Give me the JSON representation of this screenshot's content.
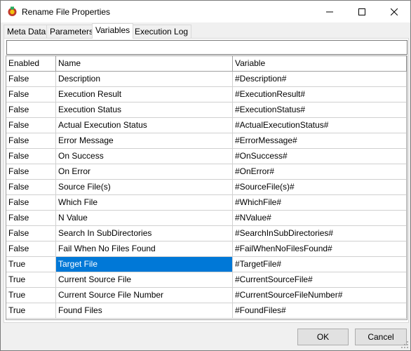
{
  "window": {
    "title": "Rename File Properties"
  },
  "tabs": [
    {
      "label": "Meta Data"
    },
    {
      "label": "Parameters"
    },
    {
      "label": "Variables"
    },
    {
      "label": "Execution Log"
    }
  ],
  "active_tab": "Variables",
  "filter": {
    "value": ""
  },
  "grid": {
    "headers": [
      "Enabled",
      "Name",
      "Variable"
    ],
    "rows": [
      {
        "enabled": "False",
        "name": "Description",
        "variable": "#Description#"
      },
      {
        "enabled": "False",
        "name": "Execution Result",
        "variable": "#ExecutionResult#"
      },
      {
        "enabled": "False",
        "name": "Execution Status",
        "variable": "#ExecutionStatus#"
      },
      {
        "enabled": "False",
        "name": "Actual Execution Status",
        "variable": "#ActualExecutionStatus#"
      },
      {
        "enabled": "False",
        "name": "Error Message",
        "variable": "#ErrorMessage#"
      },
      {
        "enabled": "False",
        "name": "On Success",
        "variable": "#OnSuccess#"
      },
      {
        "enabled": "False",
        "name": "On Error",
        "variable": "#OnError#"
      },
      {
        "enabled": "False",
        "name": "Source File(s)",
        "variable": "#SourceFile(s)#"
      },
      {
        "enabled": "False",
        "name": "Which File",
        "variable": "#WhichFile#"
      },
      {
        "enabled": "False",
        "name": "N Value",
        "variable": "#NValue#"
      },
      {
        "enabled": "False",
        "name": "Search In SubDirectories",
        "variable": "#SearchInSubDirectories#"
      },
      {
        "enabled": "False",
        "name": "Fail When No Files Found",
        "variable": "#FailWhenNoFilesFound#"
      },
      {
        "enabled": "True",
        "name": "Target File",
        "variable": "#TargetFile#"
      },
      {
        "enabled": "True",
        "name": "Current Source File",
        "variable": "#CurrentSourceFile#"
      },
      {
        "enabled": "True",
        "name": "Current Source File Number",
        "variable": "#CurrentSourceFileNumber#"
      },
      {
        "enabled": "True",
        "name": "Found Files",
        "variable": "#FoundFiles#"
      }
    ],
    "selected_row": 12
  },
  "buttons": {
    "ok": "OK",
    "cancel": "Cancel"
  },
  "colors": {
    "selection": "#0078d7",
    "window_bg": "#f0f0f0"
  },
  "icons": {
    "app": "gear-cube-icon",
    "minimize": "minimize-icon",
    "maximize": "maximize-icon",
    "close": "close-icon"
  }
}
